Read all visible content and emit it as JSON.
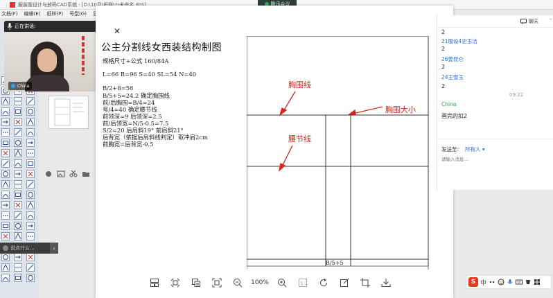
{
  "cad_window": {
    "title": "服装版设计与放码CAD系统 - [D:\\10月\\纸样\\1\\未命名.dgs]",
    "menu": [
      "文档(F)",
      "编辑(E)",
      "纸样(P)",
      "号型(G)",
      "显示"
    ]
  },
  "meeting": {
    "badge": "腾讯会议",
    "speaker_label": "正在讲话:",
    "speaker_name": "China",
    "side_widget_label": "说点什么..."
  },
  "document": {
    "title": "公主分割线女西装结构制图",
    "lines": [
      "规格尺寸+公式    160/84A",
      "L=66   B=96   S=40   SL=54   N=40",
      "B/2+8=56",
      "B/5+5=24.2  确定胸围线",
      "前/后胸围=B/4=24",
      "号/4=40    确定腰节线",
      "前领深=9  后领深=2.5",
      "前/后领宽=N/5-0.5=7.5",
      "S/2=20  后肩斜19°   前肩斜21°",
      "后背宽（依据后肩斜线判定）取冲肩2cm",
      "前胸宽=后背宽-0.5"
    ],
    "labels": {
      "chest_line": "胸围线",
      "chest_size": "胸围大小",
      "waist_line": "腰节线",
      "bottom_dim": "B/5+5"
    }
  },
  "viewer_toolbar": {
    "zoom": "100%",
    "icons": [
      "thumbnail-icon",
      "fit-width-icon",
      "ocr-icon",
      "fullscreen-icon",
      "zoom-out-icon",
      "zoom-in-icon",
      "actual-size-icon",
      "rotate-icon",
      "edit-icon",
      "crop-icon",
      "download-icon"
    ]
  },
  "chat": {
    "header": "聊天",
    "messages": [
      {
        "name": "",
        "text": "2"
      },
      {
        "name": "21服设4史玉洁",
        "text": "2"
      },
      {
        "name": "26姜昆仑",
        "text": "2"
      },
      {
        "name": "24王雪玉",
        "text": "2"
      }
    ],
    "time": "09:22",
    "self_name": "China",
    "self_msg": "画完的扣2",
    "send_to_label": "发送至:",
    "send_to_value": "所有人",
    "input_placeholder": "请输入消息..."
  },
  "ime": {
    "logo": "S",
    "mode": "中"
  },
  "colors": {
    "accent_red": "#d9261c",
    "chat_blue": "#2b6fd6",
    "chat_green": "#25a35a",
    "meeting_green": "#2fb35a"
  }
}
